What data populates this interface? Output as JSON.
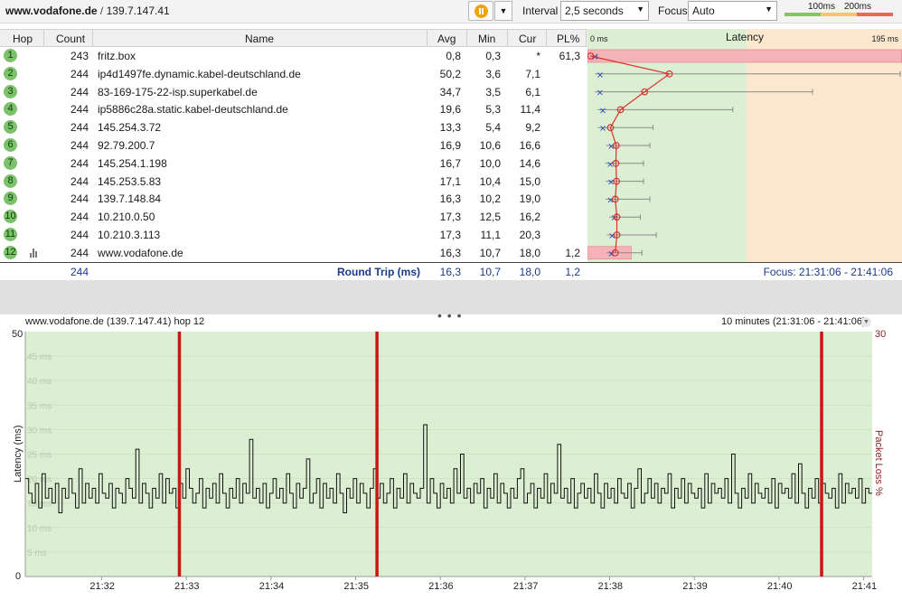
{
  "toolbar": {
    "host": "www.vodafone.de",
    "separator": "/",
    "ip": "139.7.147.41",
    "interval_label": "Interval",
    "interval_value": "2,5 seconds",
    "focus_label": "Focus",
    "focus_value": "Auto",
    "legend": {
      "mid_label": "100ms",
      "high_label": "200ms"
    }
  },
  "table": {
    "columns": {
      "hop": "Hop",
      "count": "Count",
      "name": "Name",
      "avg": "Avg",
      "min": "Min",
      "cur": "Cur",
      "pl": "PL%"
    },
    "rows": [
      {
        "hop": "1",
        "count": "243",
        "name": "fritz.box",
        "avg": "0,8",
        "min": "0,3",
        "cur": "*",
        "pl": "61,3"
      },
      {
        "hop": "2",
        "count": "244",
        "name": "ip4d1497fe.dynamic.kabel-deutschland.de",
        "avg": "50,2",
        "min": "3,6",
        "cur": "7,1",
        "pl": ""
      },
      {
        "hop": "3",
        "count": "244",
        "name": "83-169-175-22-isp.superkabel.de",
        "avg": "34,7",
        "min": "3,5",
        "cur": "6,1",
        "pl": ""
      },
      {
        "hop": "4",
        "count": "244",
        "name": "ip5886c28a.static.kabel-deutschland.de",
        "avg": "19,6",
        "min": "5,3",
        "cur": "11,4",
        "pl": ""
      },
      {
        "hop": "5",
        "count": "244",
        "name": "145.254.3.72",
        "avg": "13,3",
        "min": "5,4",
        "cur": "9,2",
        "pl": ""
      },
      {
        "hop": "6",
        "count": "244",
        "name": "92.79.200.7",
        "avg": "16,9",
        "min": "10,6",
        "cur": "16,6",
        "pl": ""
      },
      {
        "hop": "7",
        "count": "244",
        "name": "145.254.1.198",
        "avg": "16,7",
        "min": "10,0",
        "cur": "14,6",
        "pl": ""
      },
      {
        "hop": "8",
        "count": "244",
        "name": "145.253.5.83",
        "avg": "17,1",
        "min": "10,4",
        "cur": "15,0",
        "pl": ""
      },
      {
        "hop": "9",
        "count": "244",
        "name": "139.7.148.84",
        "avg": "16,3",
        "min": "10,2",
        "cur": "19,0",
        "pl": ""
      },
      {
        "hop": "10",
        "count": "244",
        "name": "10.210.0.50",
        "avg": "17,3",
        "min": "12,5",
        "cur": "16,2",
        "pl": ""
      },
      {
        "hop": "11",
        "count": "244",
        "name": "10.210.3.113",
        "avg": "17,3",
        "min": "11,1",
        "cur": "20,3",
        "pl": ""
      },
      {
        "hop": "12",
        "count": "244",
        "name": "www.vodafone.de",
        "avg": "16,3",
        "min": "10,7",
        "cur": "18,0",
        "pl": "1,2"
      }
    ],
    "summary": {
      "count": "244",
      "label": "Round Trip (ms)",
      "avg": "16,3",
      "min": "10,7",
      "cur": "18,0",
      "pl": "1,2",
      "focus": "Focus: 21:31:06 - 21:41:06"
    }
  },
  "latency_panel": {
    "title": "Latency",
    "min_label": "0 ms",
    "max_label": "195 ms",
    "max_ms": 195,
    "hops": [
      {
        "avg": 0.8,
        "min": 0.3,
        "max": 5
      },
      {
        "avg": 50.2,
        "min": 3.6,
        "max": 195
      },
      {
        "avg": 34.7,
        "min": 3.5,
        "max": 140
      },
      {
        "avg": 19.6,
        "min": 5.3,
        "max": 90
      },
      {
        "avg": 13.3,
        "min": 5.4,
        "max": 40
      },
      {
        "avg": 16.9,
        "min": 10.6,
        "max": 38
      },
      {
        "avg": 16.7,
        "min": 10.0,
        "max": 34
      },
      {
        "avg": 17.1,
        "min": 10.4,
        "max": 34
      },
      {
        "avg": 16.3,
        "min": 10.2,
        "max": 38
      },
      {
        "avg": 17.3,
        "min": 12.5,
        "max": 32
      },
      {
        "avg": 17.3,
        "min": 11.1,
        "max": 42
      },
      {
        "avg": 16.3,
        "min": 10.7,
        "max": 33
      }
    ],
    "loss_pct": [
      61.3,
      0,
      0,
      0,
      0,
      0,
      0,
      0,
      0,
      0,
      0,
      1.2
    ]
  },
  "graph": {
    "title": "www.vodafone.de (139.7.147.41) hop 12",
    "range": "10 minutes (21:31:06 - 21:41:06)",
    "y_max_label": "50",
    "y_min_label": "0",
    "loss_max_label": "30",
    "y_label": "Latency (ms)",
    "loss_label": "Packet Loss %",
    "gridlines": [
      "45 ms",
      "40 ms",
      "35 ms",
      "30 ms",
      "25 ms",
      "20 ms",
      "15 ms",
      "10 ms",
      "5 ms"
    ],
    "x_ticks": [
      "21:32",
      "21:33",
      "21:34",
      "21:35",
      "21:36",
      "21:37",
      "21:38",
      "21:39",
      "21:40",
      "21:41"
    ]
  },
  "chart_data": {
    "type": "line",
    "title": "www.vodafone.de (139.7.147.41) hop 12",
    "ylabel": "Latency (ms)",
    "y2label": "Packet Loss %",
    "ylim": [
      0,
      50
    ],
    "y2lim": [
      0,
      30
    ],
    "xlim": [
      "21:31:06",
      "21:41:06"
    ],
    "x_ticks": [
      "21:32",
      "21:33",
      "21:34",
      "21:35",
      "21:36",
      "21:37",
      "21:38",
      "21:39",
      "21:40",
      "21:41"
    ],
    "loss_events": [
      "21:32:55",
      "21:35:15",
      "21:40:30"
    ],
    "latency_samples": [
      20,
      17,
      15,
      19,
      14,
      21,
      16,
      18,
      15,
      19,
      13,
      18,
      16,
      20,
      17,
      14,
      22,
      15,
      19,
      16,
      18,
      15,
      21,
      17,
      16,
      19,
      14,
      18,
      17,
      15,
      20,
      18,
      16,
      26,
      15,
      19,
      17,
      14,
      18,
      16,
      21,
      15,
      20,
      17,
      18,
      14,
      19,
      16,
      22,
      18,
      15,
      17,
      20,
      14,
      18,
      16,
      19,
      15,
      21,
      17,
      14,
      18,
      16,
      20,
      15,
      19,
      17,
      28,
      16,
      18,
      15,
      19,
      14,
      17,
      20,
      16,
      18,
      15,
      21,
      17,
      14,
      19,
      16,
      18,
      24,
      15,
      17,
      20,
      14,
      19,
      16,
      18,
      15,
      21,
      17,
      13,
      18,
      16,
      20,
      15,
      19,
      17,
      14,
      18,
      22,
      16,
      19,
      15,
      17,
      20,
      14,
      18,
      16,
      21,
      15,
      19,
      17,
      16,
      18,
      31,
      15,
      20,
      17,
      14,
      19,
      16,
      18,
      15,
      22,
      17,
      25,
      16,
      18,
      15,
      19,
      17,
      20,
      14,
      18,
      16,
      21,
      15,
      19,
      17,
      14,
      18,
      16,
      20,
      22,
      15,
      17,
      19,
      14,
      18,
      16,
      21,
      15,
      19,
      17,
      27,
      16,
      18,
      15,
      20,
      14,
      17,
      19,
      16,
      18,
      15,
      21,
      17,
      14,
      19,
      16,
      18,
      15,
      20,
      17,
      16,
      19,
      14,
      18,
      22,
      15,
      17,
      20,
      16,
      19,
      15,
      18,
      17,
      21,
      14,
      18,
      16,
      20,
      15,
      19,
      17,
      16,
      18,
      14,
      21,
      15,
      19,
      17,
      18,
      16,
      20,
      15,
      25,
      17,
      14,
      18,
      16,
      21,
      15,
      19,
      17,
      16,
      18,
      15,
      20,
      14,
      19,
      17,
      18,
      16,
      21,
      15,
      23,
      17,
      14,
      18,
      16,
      20,
      15,
      19,
      17,
      16,
      18,
      14,
      21,
      15,
      19,
      17,
      18,
      16,
      20,
      15,
      18,
      17
    ]
  }
}
